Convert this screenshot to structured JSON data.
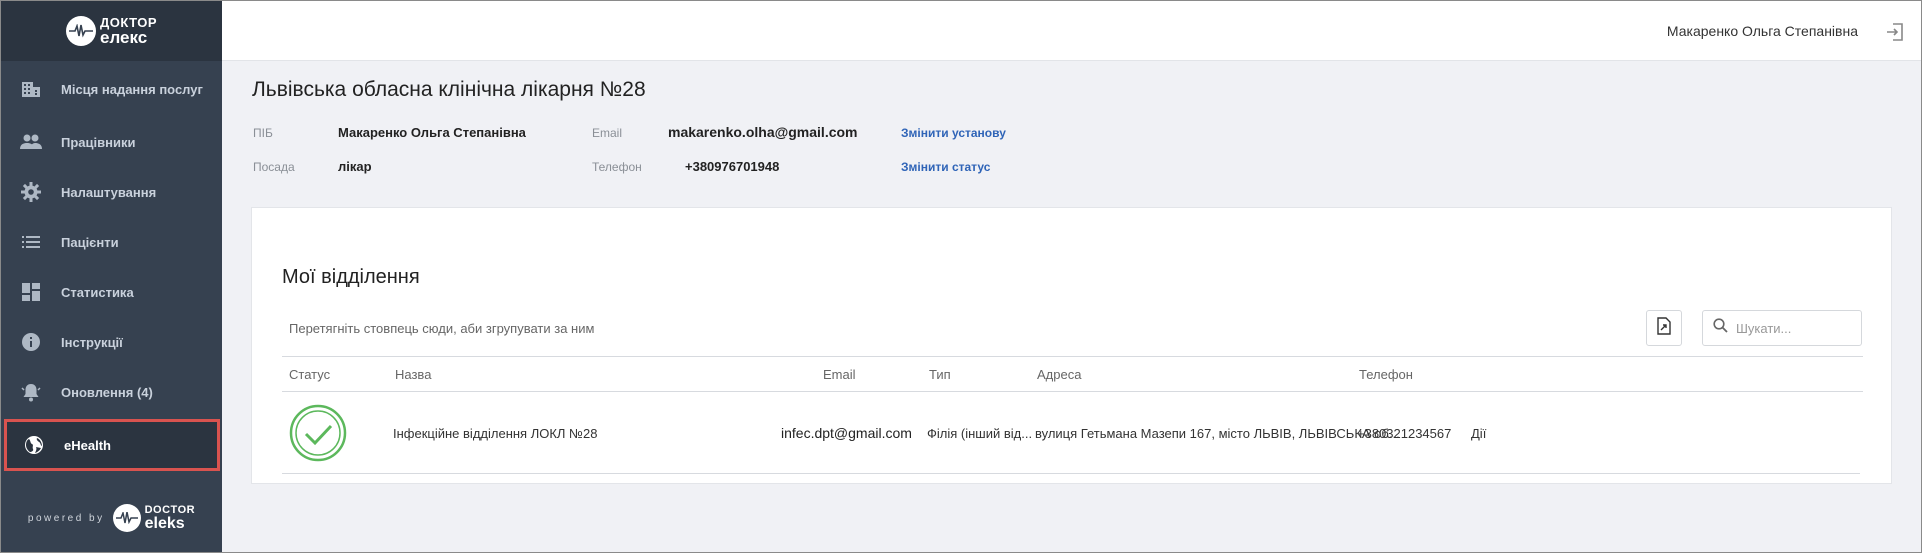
{
  "brand": {
    "logo_line1": "ДОКТОР",
    "logo_line2": "ЕЛЕКС",
    "powered_by": "powered by",
    "footer_line1": "DOCTOR",
    "footer_line2": "ELEKS"
  },
  "sidebar": {
    "items": [
      {
        "label": "Місця надання послуг",
        "icon": "building-icon"
      },
      {
        "label": "Працівники",
        "icon": "people-icon"
      },
      {
        "label": "Налаштування",
        "icon": "gear-icon"
      },
      {
        "label": "Пацієнти",
        "icon": "list-icon"
      },
      {
        "label": "Статистика",
        "icon": "dashboard-icon"
      },
      {
        "label": "Інструкції",
        "icon": "info-icon"
      },
      {
        "label": "Оновлення (4)",
        "icon": "bell-icon"
      },
      {
        "label": "eHealth",
        "icon": "globe-icon",
        "active": true
      }
    ]
  },
  "header": {
    "user_name": "Макаренко Ольга Степанівна"
  },
  "clinic": {
    "title": "Львівська обласна клінічна лікарня №28",
    "pib_label": "ПІБ",
    "pib_value": "Макаренко Ольга Степанівна",
    "position_label": "Посада",
    "position_value": "лікар",
    "email_label": "Email",
    "email_value": "makarenko.olha@gmail.com",
    "phone_label": "Телефон",
    "phone_value": "+380976701948",
    "change_institution": "Змінити установу",
    "change_status": "Змінити статус"
  },
  "departments": {
    "title": "Мої відділення",
    "group_hint": "Перетягніть стовпець сюди, аби згрупувати за ним",
    "search_placeholder": "Шукати...",
    "columns": [
      "Статус",
      "Назва",
      "Email",
      "Тип",
      "Адреса",
      "Телефон"
    ],
    "rows": [
      {
        "status": "active",
        "name": "Інфекційне відділення ЛОКЛ №28",
        "email": "infec.dpt@gmail.com",
        "type": "Філія (інший від...",
        "address": "вулиця Гетьмана Мазепи 167, місто ЛЬВІВ, ЛЬВІВСЬКА об...",
        "phone": "+380321234567",
        "actions": "Дії"
      }
    ]
  },
  "colors": {
    "sidebar_bg": "#364150",
    "sidebar_dark": "#2b3440",
    "link": "#2f64b7",
    "active_border": "#d9534f",
    "status_green": "#5cb85c"
  }
}
